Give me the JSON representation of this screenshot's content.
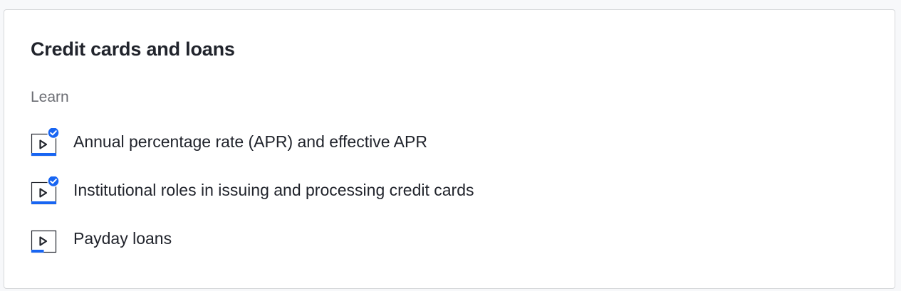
{
  "unit": {
    "title": "Credit cards and loans",
    "section_label": "Learn"
  },
  "lessons": [
    {
      "label": "Annual percentage rate (APR) and effective APR",
      "type": "video",
      "completed": true,
      "progress": 1.0
    },
    {
      "label": "Institutional roles in issuing and processing credit cards",
      "type": "video",
      "completed": true,
      "progress": 1.0
    },
    {
      "label": "Payday loans",
      "type": "video",
      "completed": false,
      "progress": 0.5
    }
  ],
  "colors": {
    "accent": "#1865f2",
    "text": "#21242c",
    "muted": "#6b6d73",
    "border": "#d6d8da",
    "background": "#f7f8fa"
  }
}
